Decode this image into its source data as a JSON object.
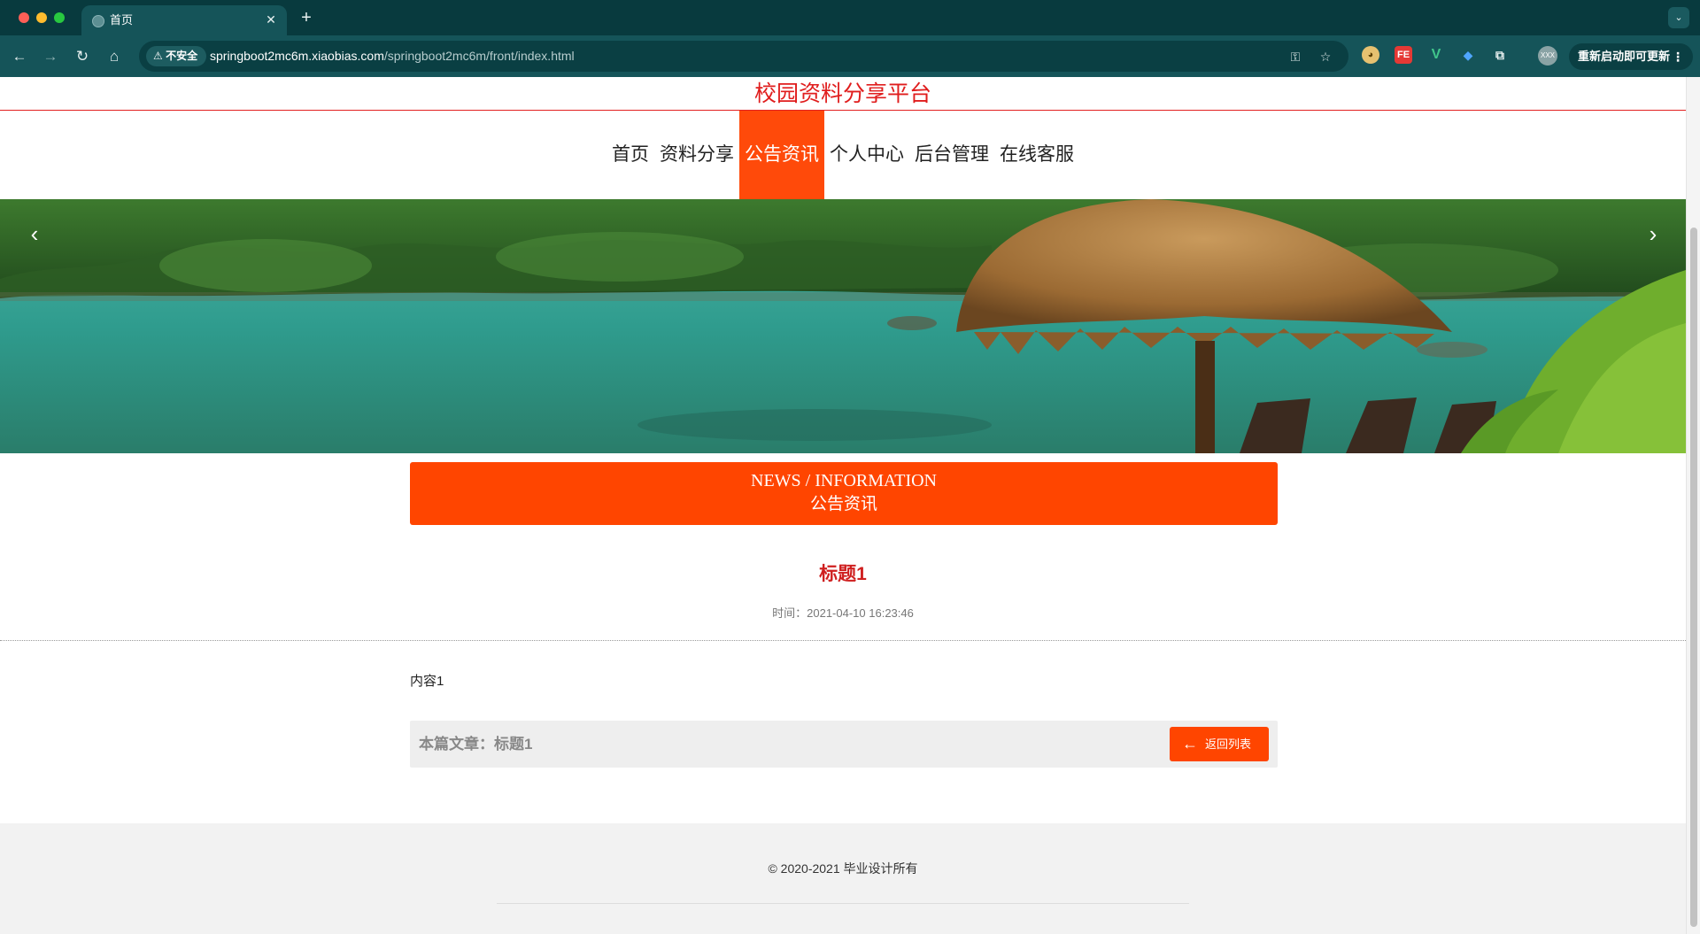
{
  "browser": {
    "tab_title": "首页",
    "tab_close": "✕",
    "new_tab": "+",
    "tab_menu": "⌄",
    "security_label": "不安全",
    "url_host": "springboot2mc6m.xiaobias.com",
    "url_path": "/springboot2mc6m/front/index.html",
    "update_label": "重新启动即可更新",
    "menu_dots": "⋮",
    "ext_fe": "FE",
    "ext_v": "V",
    "profile_text": "XXX"
  },
  "site": {
    "title": "校园资料分享平台",
    "nav": [
      "首页",
      "资料分享",
      "公告资讯",
      "个人中心",
      "后台管理",
      "在线客服"
    ],
    "active_nav": "公告资讯"
  },
  "banner": {
    "prev_label": "‹",
    "next_label": "›"
  },
  "section": {
    "title_en": "NEWS / INFORMATION",
    "title_cn": "公告资讯"
  },
  "article": {
    "title": "标题1",
    "time_label": "时间：",
    "time_value": "2021-04-10 16:23:46",
    "content": "内容1",
    "current_label": "本篇文章：标题1",
    "back_label": "返回列表",
    "back_arrow": "←"
  },
  "footer": {
    "copyright": "© 2020-2021 毕业设计所有"
  },
  "colors": {
    "accent": "#ff4500",
    "title_red": "#e01d1d",
    "chrome_dark": "#083a3e",
    "chrome_toolbar": "#155459"
  }
}
